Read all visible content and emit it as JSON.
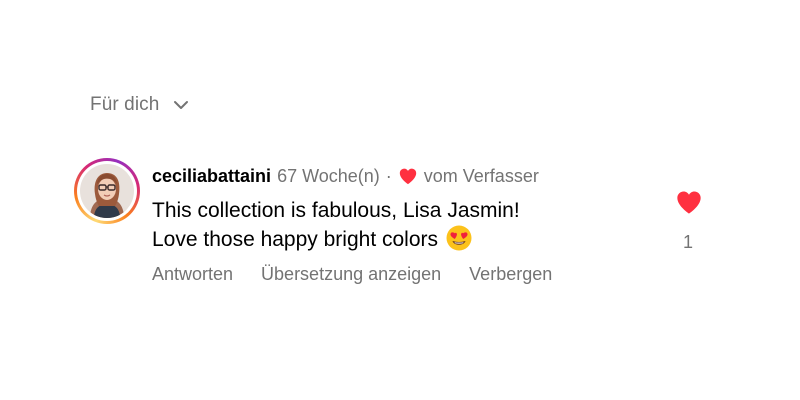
{
  "sort": {
    "label": "Für dich",
    "icon": "chevron-down-icon"
  },
  "comment": {
    "username": "ceciliabattaini",
    "timestamp": "67 Woche(n)",
    "separator": "·",
    "liked_by_author_label": "vom Verfasser",
    "liked_by_author_icon": "heart-icon",
    "text_line_1": "This collection is fabulous, Lisa Jasmin!",
    "text_line_2": "Love those happy bright colors",
    "emoji": "heart-eyes-emoji",
    "like_count": "1",
    "like_icon": "heart-icon",
    "liked": true
  },
  "actions": {
    "reply": "Antworten",
    "translate": "Übersetzung anzeigen",
    "hide": "Verbergen"
  },
  "colors": {
    "like_red": "#ff3040",
    "secondary_text": "#737373",
    "primary_text": "#000000"
  }
}
